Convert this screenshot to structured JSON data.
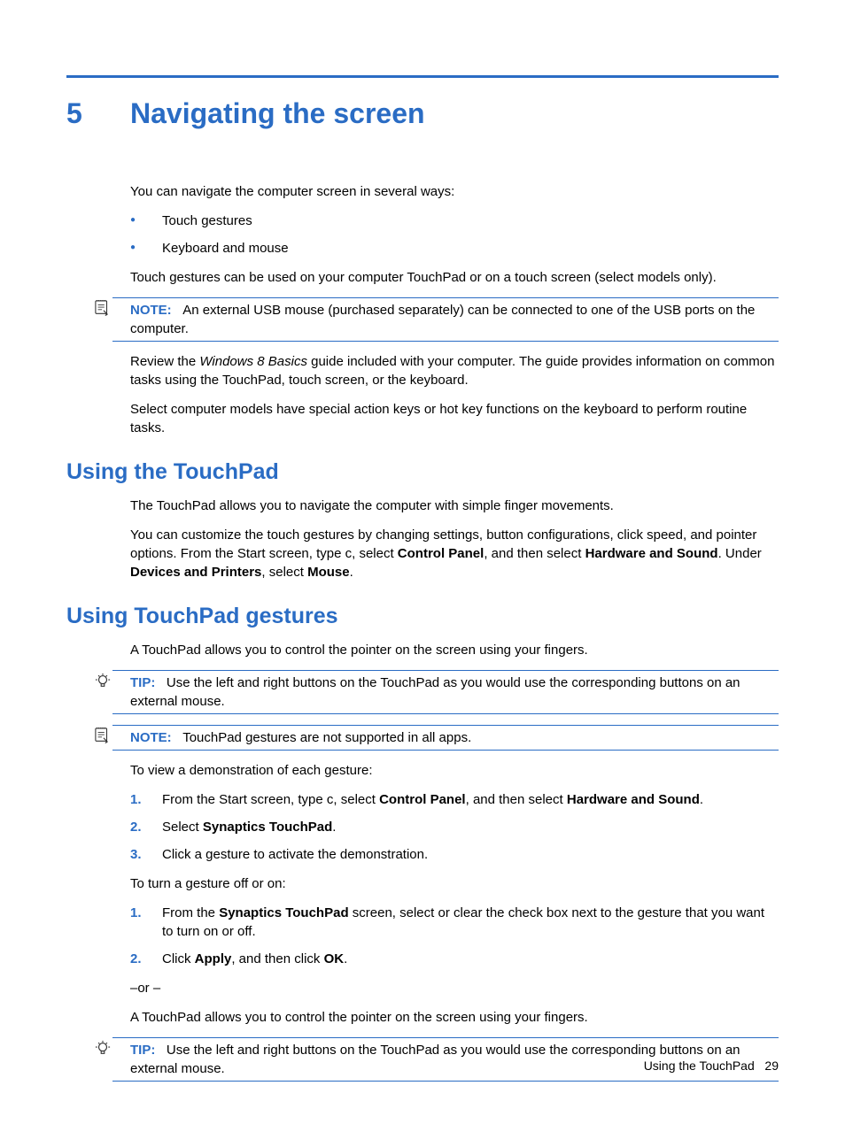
{
  "chapter": {
    "number": "5",
    "title": "Navigating the screen"
  },
  "intro": {
    "lead": "You can navigate the computer screen in several ways:",
    "bullets": [
      "Touch gestures",
      "Keyboard and mouse"
    ],
    "after_bullets": "Touch gestures can be used on your computer TouchPad or on a touch screen (select models only).",
    "note1_label": "NOTE:",
    "note1_text": "An external USB mouse (purchased separately) can be connected to one of the USB ports on the computer.",
    "review_pre": "Review the ",
    "review_em": "Windows 8 Basics",
    "review_post": " guide included with your computer. The guide provides information on common tasks using the TouchPad, touch screen, or the keyboard.",
    "special_keys": "Select computer models have special action keys or hot key functions on the keyboard to perform routine tasks."
  },
  "section_touchpad": {
    "heading": "Using the TouchPad",
    "p1": "The TouchPad allows you to navigate the computer with simple finger movements.",
    "p2_a": "You can customize the touch gestures by changing settings, button configurations, click speed, and pointer options. From the Start screen, type ",
    "p2_c": "c",
    "p2_b": ", select ",
    "p2_cp": "Control Panel",
    "p2_c2": ", and then select ",
    "p2_hs": "Hardware and Sound",
    "p2_d": ". Under ",
    "p2_dp": "Devices and Printers",
    "p2_e": ", select ",
    "p2_mouse": "Mouse",
    "p2_end": "."
  },
  "section_gestures": {
    "heading": "Using TouchPad gestures",
    "p1": "A TouchPad allows you to control the pointer on the screen using your fingers.",
    "tip1_label": "TIP:",
    "tip1_text": "Use the left and right buttons on the TouchPad as you would use the corresponding buttons on an external mouse.",
    "note2_label": "NOTE:",
    "note2_text": "TouchPad gestures are not supported in all apps.",
    "demo_intro": "To view a demonstration of each gesture:",
    "steps1": {
      "s1_a": "From the Start screen, type ",
      "s1_c": "c",
      "s1_b": ", select ",
      "s1_cp": "Control Panel",
      "s1_c2": ", and then select ",
      "s1_hs": "Hardware and Sound",
      "s1_end": ".",
      "s2_a": "Select ",
      "s2_b": "Synaptics TouchPad",
      "s2_end": ".",
      "s3": "Click a gesture to activate the demonstration."
    },
    "toggle_intro": "To turn a gesture off or on:",
    "steps2": {
      "s1_a": "From the ",
      "s1_b": "Synaptics TouchPad",
      "s1_c": " screen, select or clear the check box next to the gesture that you want to turn on or off.",
      "s2_a": "Click ",
      "s2_b": "Apply",
      "s2_c": ", and then click ",
      "s2_d": "OK",
      "s2_end": "."
    },
    "or": "–or –",
    "p_repeat": "A TouchPad allows you to control the pointer on the screen using your fingers.",
    "tip2_label": "TIP:",
    "tip2_text": "Use the left and right buttons on the TouchPad as you would use the corresponding buttons on an external mouse."
  },
  "footer": {
    "text": "Using the TouchPad",
    "page": "29"
  }
}
